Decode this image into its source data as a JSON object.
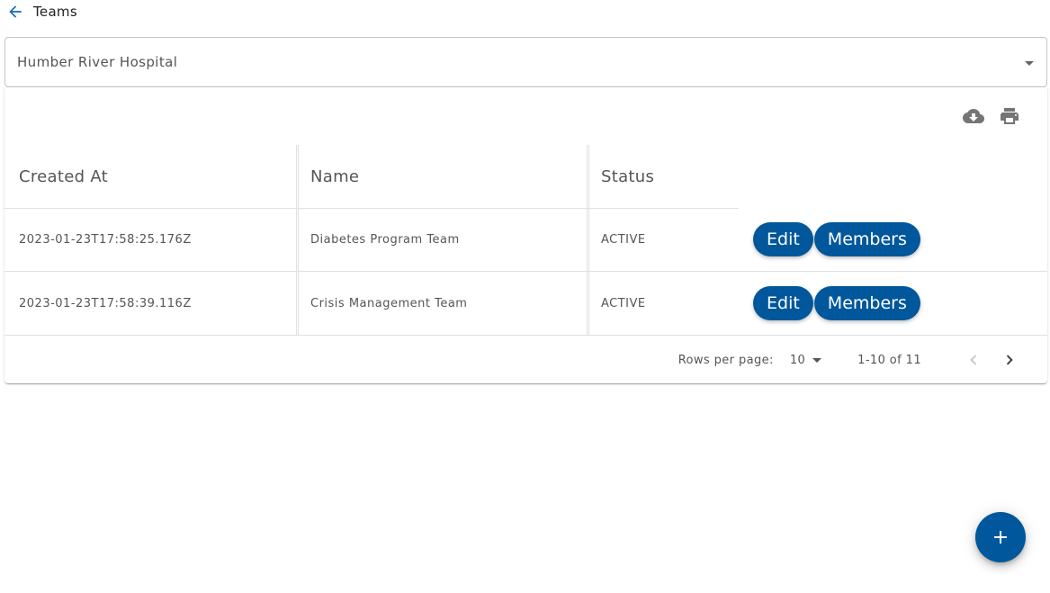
{
  "header": {
    "title": "Teams",
    "back_icon": "arrow-back-icon"
  },
  "organization_select": {
    "value": "Humber River Hospital"
  },
  "toolbar": {
    "download_icon": "cloud-download-icon",
    "print_icon": "print-icon"
  },
  "table": {
    "columns": [
      "Created At",
      "Name",
      "Status"
    ],
    "rows": [
      {
        "created_at": "2023-01-23T17:58:25.176Z",
        "name": "Diabetes Program Team",
        "status": "ACTIVE",
        "edit_label": "Edit",
        "members_label": "Members"
      },
      {
        "created_at": "2023-01-23T17:58:39.116Z",
        "name": "Crisis Management Team",
        "status": "ACTIVE",
        "edit_label": "Edit",
        "members_label": "Members"
      }
    ]
  },
  "pagination": {
    "rows_per_page_label": "Rows per page:",
    "rows_per_page_value": "10",
    "range": "1-10 of 11",
    "prev_icon": "chevron-left-icon",
    "next_icon": "chevron-right-icon",
    "prev_disabled": true
  },
  "fab": {
    "icon": "plus-icon"
  },
  "colors": {
    "primary": "#01579b",
    "back_arrow": "#1565c0"
  }
}
